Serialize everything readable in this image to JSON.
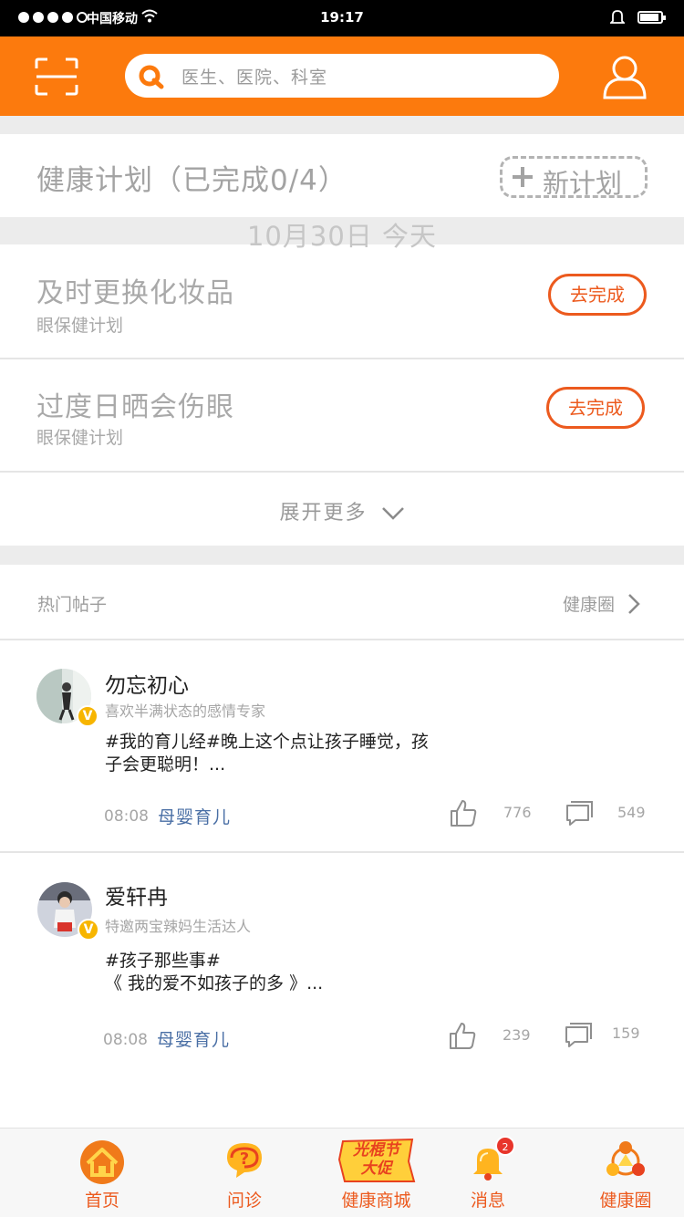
{
  "status_bar": {
    "carrier": "中国移动",
    "time": "19:17"
  },
  "header": {
    "search_placeholder": "医生、医院、科室"
  },
  "plans": {
    "title": "健康计划（已完成0/4）",
    "new_plan": "新计划",
    "date_label": "10月30日  今天",
    "items": [
      {
        "name": "及时更换化妆品",
        "category": "眼保健计划",
        "action": "去完成"
      },
      {
        "name": "过度日晒会伤眼",
        "category": "眼保健计划",
        "action": "去完成"
      }
    ],
    "expand_more": "展开更多"
  },
  "hot_posts": {
    "title": "热门帖子",
    "circle_link": "健康圈",
    "posts": [
      {
        "user": "勿忘初心",
        "desc": "喜欢半满状态的感情专家",
        "text": "#我的育儿经#晚上这个点让孩子睡觉，孩子会更聪明！...",
        "time": "08:08",
        "tag": "母婴育儿",
        "likes": "776",
        "comments": "549"
      },
      {
        "user": "爱轩冉",
        "desc": "特邀两宝辣妈生活达人",
        "text": "#孩子那些事#\n《 我的爱不如孩子的多 》...",
        "time": "08:08",
        "tag": "母婴育儿",
        "likes": "239",
        "comments": "159"
      }
    ]
  },
  "tabbar": {
    "items": [
      {
        "label": "首页",
        "icon": "home-icon"
      },
      {
        "label": "问诊",
        "icon": "consult-icon"
      },
      {
        "label": "健康商城",
        "icon": "promo-icon",
        "promo_text_1": "光棍节",
        "promo_text_2": "大促"
      },
      {
        "label": "消息",
        "icon": "bell-icon",
        "badge": "2"
      },
      {
        "label": "健康圈",
        "icon": "circle-icon"
      }
    ]
  },
  "colors": {
    "brand": "#fc7a0d",
    "accent": "#ec5a1e",
    "link": "#4a6fa5"
  }
}
